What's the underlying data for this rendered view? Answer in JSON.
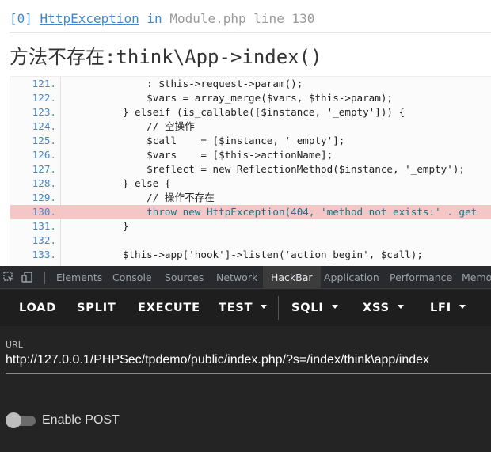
{
  "exception": {
    "index": "[0]",
    "class_name": "HttpException",
    "in_word": "in",
    "location": "Module.php line 130",
    "message": "方法不存在:think\\App->index()"
  },
  "code": {
    "lines": [
      {
        "num": "121.",
        "text": "              : $this->request->param();"
      },
      {
        "num": "122.",
        "text": "              $vars = array_merge($vars, $this->param);"
      },
      {
        "num": "123.",
        "text": "          } elseif (is_callable([$instance, '_empty'])) {"
      },
      {
        "num": "124.",
        "text": "              // 空操作"
      },
      {
        "num": "125.",
        "text": "              $call    = [$instance, '_empty'];"
      },
      {
        "num": "126.",
        "text": "              $vars    = [$this->actionName];"
      },
      {
        "num": "127.",
        "text": "              $reflect = new ReflectionMethod($instance, '_empty');"
      },
      {
        "num": "128.",
        "text": "          } else {"
      },
      {
        "num": "129.",
        "text": "              // 操作不存在"
      },
      {
        "num": "130.",
        "text": "              throw new HttpException(404, 'method not exists:' . get"
      },
      {
        "num": "131.",
        "text": "          }"
      },
      {
        "num": "132.",
        "text": ""
      },
      {
        "num": "133.",
        "text": "          $this->app['hook']->listen('action_begin', $call);"
      }
    ]
  },
  "devtools": {
    "tabs": [
      "Elements",
      "Console",
      "Sources",
      "Network",
      "HackBar",
      "Application",
      "Performance",
      "Memory"
    ],
    "active_tab": "HackBar"
  },
  "hackbar": {
    "buttons": {
      "load": "LOAD",
      "split": "SPLIT",
      "execute": "EXECUTE",
      "test": "TEST",
      "sqli": "SQLI",
      "xss": "XSS",
      "lfi": "LFI"
    },
    "url_label": "URL",
    "url_value": "http://127.0.0.1/PHPSec/tpdemo/public/index.php/?s=/index/think\\app/index",
    "enable_post_label": "Enable POST",
    "enable_post": false
  },
  "colors": {
    "highlight_line": "#f5c6c6",
    "devtools_bg": "#242424",
    "link_blue": "#4288ce"
  }
}
